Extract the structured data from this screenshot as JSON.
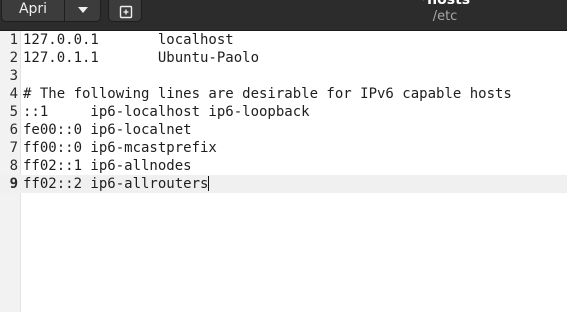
{
  "header": {
    "open_label": "Apri",
    "title": "*hosts",
    "subtitle": "/etc"
  },
  "icons": {
    "open_menu": "chevron-down-icon",
    "new_tab": "new-document-icon"
  },
  "editor": {
    "current_line": 9,
    "lines": [
      {
        "num": "1",
        "text": "127.0.0.1       localhost"
      },
      {
        "num": "2",
        "text": "127.0.1.1       Ubuntu-Paolo"
      },
      {
        "num": "3",
        "text": ""
      },
      {
        "num": "4",
        "text": "# The following lines are desirable for IPv6 capable hosts"
      },
      {
        "num": "5",
        "text": "::1     ip6-localhost ip6-loopback"
      },
      {
        "num": "6",
        "text": "fe00::0 ip6-localnet"
      },
      {
        "num": "7",
        "text": "ff00::0 ip6-mcastprefix"
      },
      {
        "num": "8",
        "text": "ff02::1 ip6-allnodes"
      },
      {
        "num": "9",
        "text": "ff02::2 ip6-allrouters"
      }
    ]
  }
}
